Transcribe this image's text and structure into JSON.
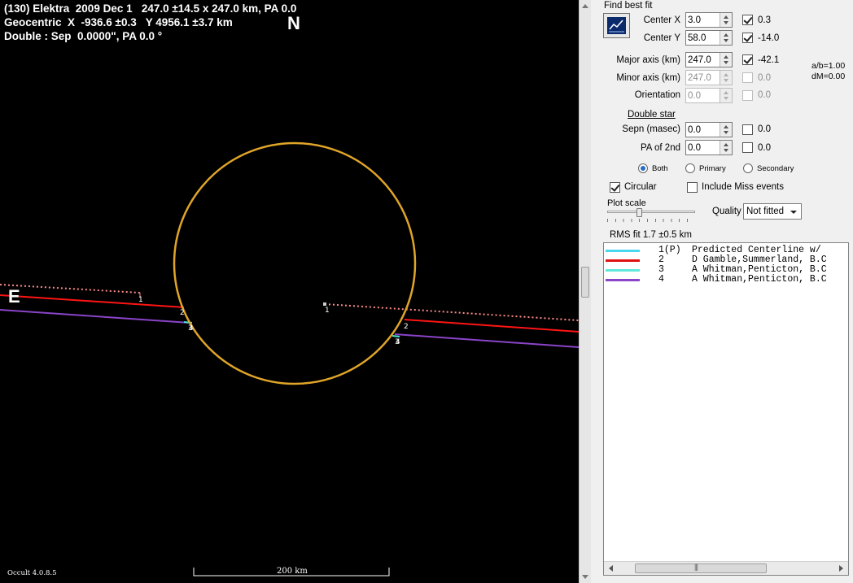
{
  "plot": {
    "header_line1": "(130) Elektra  2009 Dec 1   247.0 ±14.5 x 247.0 km, PA 0.0",
    "header_line2": "Geocentric  X  -936.6 ±0.3   Y 4956.1 ±3.7 km",
    "header_line3": "Double : Sep  0.0000\", PA 0.0 °",
    "north_label": "N",
    "east_label": "E",
    "version": "Occult 4.0.8.5",
    "scale_label": "200 km",
    "chord_labels": [
      "1",
      "2",
      "3",
      "4"
    ],
    "colors": {
      "background": "#000000",
      "ellipse": "#e0a528",
      "predicted": "#ff8a8a",
      "chord2": "#ff1414",
      "chord3": "#49e6d6",
      "chord4": "#8a44c8"
    }
  },
  "panel": {
    "find_best_fit": "Find best fit",
    "center_x": {
      "label": "Center X",
      "value": "3.0",
      "fit_checked": true,
      "fit_value": "0.3"
    },
    "center_y": {
      "label": "Center Y",
      "value": "58.0",
      "fit_checked": true,
      "fit_value": "-14.0"
    },
    "major_axis": {
      "label": "Major axis (km)",
      "value": "247.0",
      "fit_checked": true,
      "fit_value": "-42.1"
    },
    "minor_axis": {
      "label": "Minor axis (km)",
      "value": "247.0",
      "fit_checked": false,
      "fit_value": "0.0"
    },
    "orientation": {
      "label": "Orientation",
      "value": "0.0",
      "fit_checked": false,
      "fit_value": "0.0"
    },
    "ab_ratio": "a/b=1.00",
    "dm": "dM=0.00",
    "double_star": "Double star",
    "sepn": {
      "label": "Sepn (masec)",
      "value": "0.0",
      "fit_checked": false,
      "fit_value": "0.0"
    },
    "pa2": {
      "label": "PA of 2nd",
      "value": "0.0",
      "fit_checked": false,
      "fit_value": "0.0"
    },
    "radios": [
      {
        "label": "Both",
        "selected": true
      },
      {
        "label": "Primary",
        "selected": false
      },
      {
        "label": "Secondary",
        "selected": false
      }
    ],
    "circular": {
      "label": "Circular",
      "checked": true
    },
    "include_miss": {
      "label": "Include Miss events",
      "checked": false
    },
    "plot_scale": "Plot scale",
    "plot_scale_level": 0.38,
    "quality_label": "Quality",
    "quality_value": "Not fitted",
    "rms_fit": "RMS fit  1.7 ±0.5 km"
  },
  "legend": [
    {
      "num": "1(P)",
      "text": "Predicted Centerline w/",
      "color": "#49d8f0"
    },
    {
      "num": "2",
      "text": "D Gamble,Summerland, B.C",
      "color": "#e01010"
    },
    {
      "num": "3",
      "text": "A Whitman,Penticton, B.C",
      "color": "#5fe8dc"
    },
    {
      "num": "4",
      "text": "A Whitman,Penticton, B.C",
      "color": "#8a44c8"
    }
  ]
}
